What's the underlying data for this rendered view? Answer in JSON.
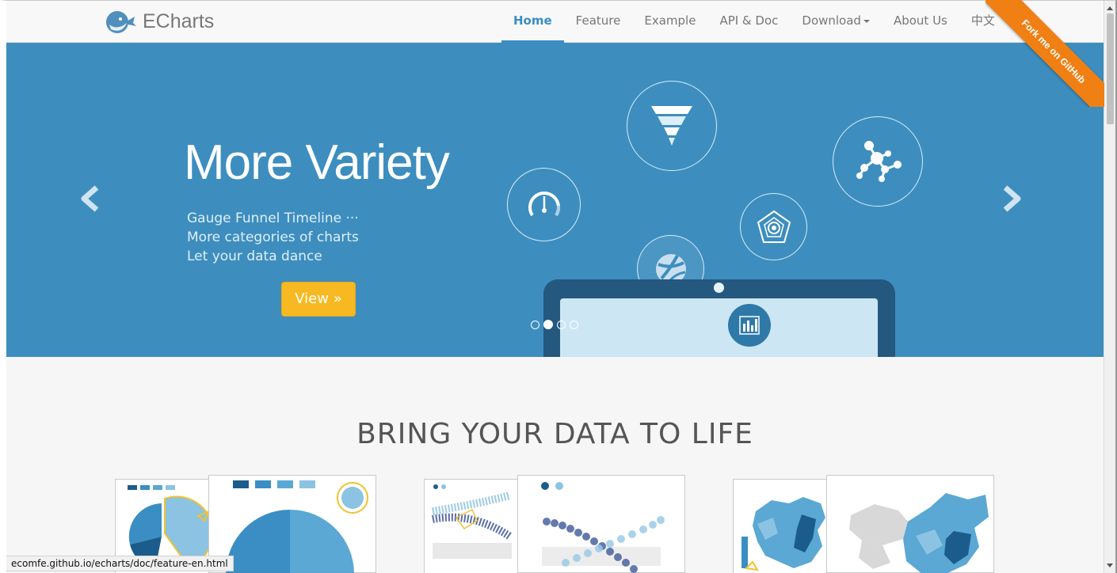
{
  "brand": {
    "name": "ECharts",
    "logo_icon": "whale-logo-icon"
  },
  "nav": {
    "items": [
      {
        "label": "Home",
        "active": true
      },
      {
        "label": "Feature"
      },
      {
        "label": "Example"
      },
      {
        "label": "API & Doc"
      },
      {
        "label": "Download"
      },
      {
        "label": "About Us"
      },
      {
        "label": "中文"
      }
    ]
  },
  "ribbon": {
    "label": "Fork me on GitHub",
    "color": "#f07f14"
  },
  "hero": {
    "title": "More Variety",
    "lines": [
      "Gauge Funnel Timeline ···",
      "More categories of charts",
      "Let your data dance"
    ],
    "button": "View »",
    "background": "#3d8ebf",
    "button_color": "#f6b921",
    "slides": 4,
    "active_slide": 1,
    "bubbles": [
      "gauge-icon",
      "funnel-icon",
      "network-icon",
      "radar-icon",
      "chord-icon"
    ],
    "device_icon": "bar-chart-icon"
  },
  "section": {
    "title": "BRING YOUR DATA TO LIFE"
  },
  "thumbnails": [
    "pie-bar-preview",
    "scatter-preview",
    "map-preview"
  ],
  "status_bar": {
    "url": "ecomfe.github.io/echarts/doc/feature-en.html"
  }
}
